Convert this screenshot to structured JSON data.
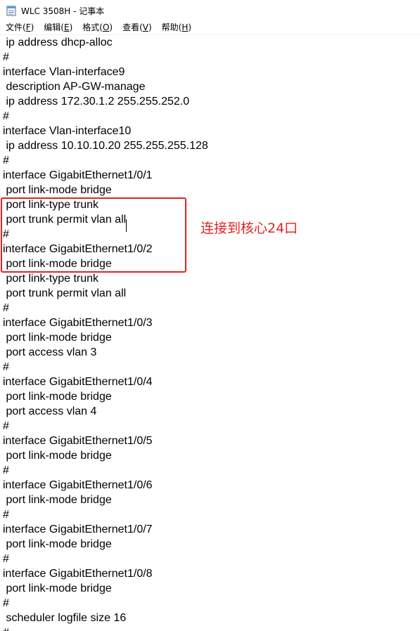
{
  "window": {
    "title": "WLC 3508H - 记事本"
  },
  "menubar": {
    "items": [
      {
        "label": "文件(",
        "accel": "F",
        "close": ")"
      },
      {
        "label": "编辑(",
        "accel": "E",
        "close": ")"
      },
      {
        "label": "格式(",
        "accel": "O",
        "close": ")"
      },
      {
        "label": "查看(",
        "accel": "V",
        "close": ")"
      },
      {
        "label": "帮助(",
        "accel": "H",
        "close": ")"
      }
    ]
  },
  "editor": {
    "lines": [
      " ip address dhcp-alloc",
      "#",
      "interface Vlan-interface9",
      " description AP-GW-manage",
      " ip address 172.30.1.2 255.255.252.0",
      "#",
      "interface Vlan-interface10",
      " ip address 10.10.10.20 255.255.255.128",
      "#",
      "interface GigabitEthernet1/0/1",
      " port link-mode bridge",
      " port link-type trunk",
      " port trunk permit vlan all",
      "#",
      "interface GigabitEthernet1/0/2",
      " port link-mode bridge",
      " port link-type trunk",
      " port trunk permit vlan all",
      "#",
      "interface GigabitEthernet1/0/3",
      " port link-mode bridge",
      " port access vlan 3",
      "#",
      "interface GigabitEthernet1/0/4",
      " port link-mode bridge",
      " port access vlan 4",
      "#",
      "interface GigabitEthernet1/0/5",
      " port link-mode bridge",
      "#",
      "interface GigabitEthernet1/0/6",
      " port link-mode bridge",
      "#",
      "interface GigabitEthernet1/0/7",
      " port link-mode bridge",
      "#",
      "interface GigabitEthernet1/0/8",
      " port link-mode bridge",
      "#",
      " scheduler logfile size 16",
      "#"
    ]
  },
  "annotation": {
    "text": "连接到核心24口",
    "color": "#e32222"
  },
  "icons": {
    "app_icon": "notepad-icon"
  }
}
